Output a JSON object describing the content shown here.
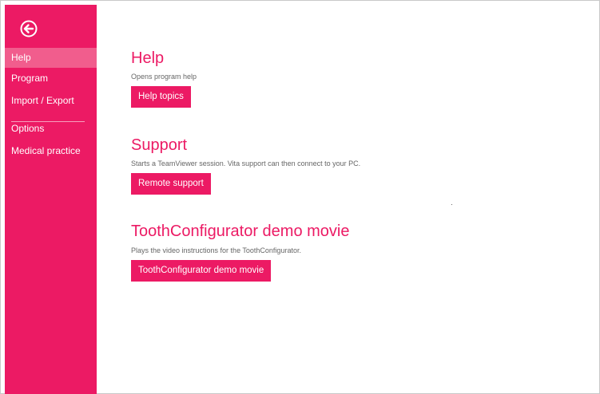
{
  "sidebar": {
    "back_icon": "arrow-left-circle-icon",
    "items": [
      {
        "label": "Help",
        "active": true
      },
      {
        "label": "Program",
        "active": false
      },
      {
        "label": "Import / Export",
        "active": false
      },
      {
        "label": "Options",
        "active": false
      },
      {
        "label": "Medical practice",
        "active": false
      }
    ]
  },
  "sections": [
    {
      "title": "Help",
      "description": "Opens program help",
      "button": "Help topics"
    },
    {
      "title": "Support",
      "description": "Starts a TeamViewer session. Vita support can then connect to your PC.",
      "button": "Remote support"
    },
    {
      "title": "ToothConfigurator demo movie",
      "description": "Plays the video instructions for the ToothConfigurator.",
      "button": "ToothConfigurator demo movie"
    }
  ],
  "colors": {
    "accent": "#ec1a64",
    "active_item": "#f15d8d",
    "text_muted": "#666666"
  }
}
